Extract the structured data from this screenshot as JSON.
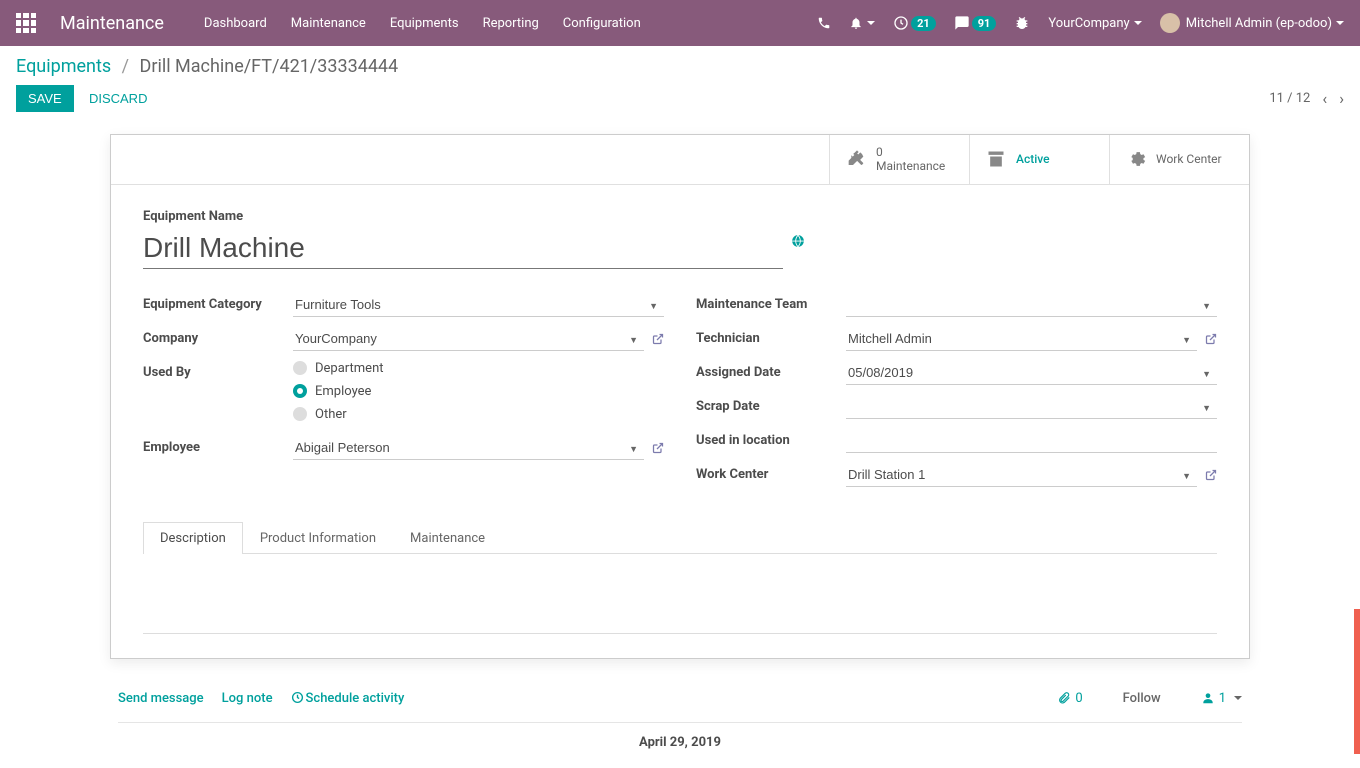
{
  "navbar": {
    "brand": "Maintenance",
    "menu": [
      "Dashboard",
      "Maintenance",
      "Equipments",
      "Reporting",
      "Configuration"
    ],
    "badge_clock": "21",
    "badge_chat": "91",
    "company": "YourCompany",
    "user": "Mitchell Admin (ep-odoo)"
  },
  "breadcrumb": {
    "root": "Equipments",
    "current": "Drill Machine/FT/421/33334444"
  },
  "buttons": {
    "save": "SAVE",
    "discard": "DISCARD"
  },
  "pager": {
    "text": "11 / 12"
  },
  "stat": {
    "maint_count": "0",
    "maint_label": "Maintenance",
    "active": "Active",
    "workcenter": "Work Center"
  },
  "form": {
    "name_label": "Equipment Name",
    "name_value": "Drill Machine",
    "labels": {
      "category": "Equipment Category",
      "company": "Company",
      "used_by": "Used By",
      "employee": "Employee",
      "team": "Maintenance Team",
      "technician": "Technician",
      "assigned": "Assigned Date",
      "scrap": "Scrap Date",
      "location": "Used in location",
      "workcenter": "Work Center"
    },
    "values": {
      "category": "Furniture Tools",
      "company": "YourCompany",
      "employee": "Abigail Peterson",
      "team": "",
      "technician": "Mitchell Admin",
      "assigned": "05/08/2019",
      "scrap": "",
      "location": "",
      "workcenter": "Drill Station 1"
    },
    "used_by_options": [
      "Department",
      "Employee",
      "Other"
    ],
    "used_by_selected": "Employee",
    "tabs": [
      "Description",
      "Product Information",
      "Maintenance"
    ]
  },
  "chatter": {
    "send": "Send message",
    "log": "Log note",
    "schedule": "Schedule activity",
    "attach_count": "0",
    "follow": "Follow",
    "followers": "1",
    "date": "April 29, 2019"
  }
}
